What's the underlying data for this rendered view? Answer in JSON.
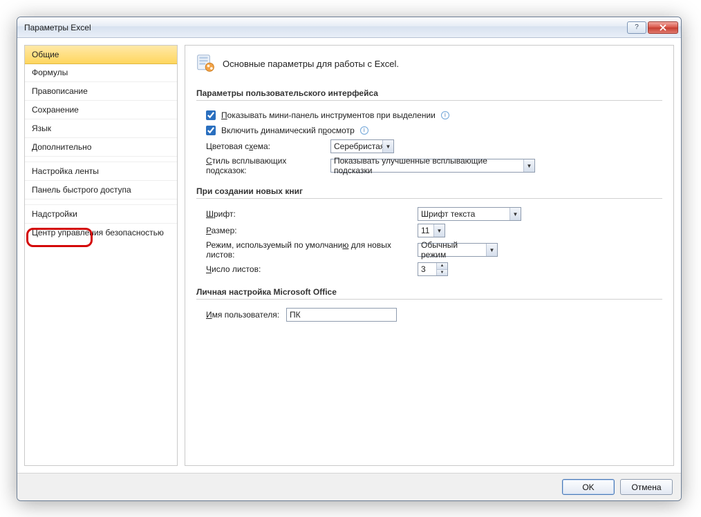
{
  "window": {
    "title": "Параметры Excel"
  },
  "sidebar": {
    "items": [
      "Общие",
      "Формулы",
      "Правописание",
      "Сохранение",
      "Язык",
      "Дополнительно",
      "Настройка ленты",
      "Панель быстрого доступа",
      "Надстройки",
      "Центр управления безопасностью"
    ],
    "selected_index": 0,
    "highlighted_index": 8
  },
  "main": {
    "title": "Основные параметры для работы с Excel.",
    "sections": {
      "ui": {
        "heading": "Параметры пользовательского интерфейса",
        "show_mini_toolbar": {
          "label": "Показывать мини-панель инструментов при выделении",
          "checked": true
        },
        "live_preview": {
          "label": "Включить динамический просмотр",
          "checked": true
        },
        "color_scheme": {
          "label": "Цветовая схема:",
          "value": "Серебристая"
        },
        "screentip_style": {
          "label": "Стиль всплывающих подсказок:",
          "value": "Показывать улучшенные всплывающие подсказки"
        }
      },
      "newbooks": {
        "heading": "При создании новых книг",
        "font": {
          "label": "Шрифт:",
          "value": "Шрифт текста"
        },
        "size": {
          "label": "Размер:",
          "value": "11"
        },
        "default_view": {
          "label": "Режим, используемый по умолчанию для новых листов:",
          "value": "Обычный режим"
        },
        "sheet_count": {
          "label": "Число листов:",
          "value": "3"
        }
      },
      "personalize": {
        "heading": "Личная настройка Microsoft Office",
        "username": {
          "label": "Имя пользователя:",
          "value": "ПК"
        }
      }
    }
  },
  "footer": {
    "ok": "OK",
    "cancel": "Отмена"
  }
}
